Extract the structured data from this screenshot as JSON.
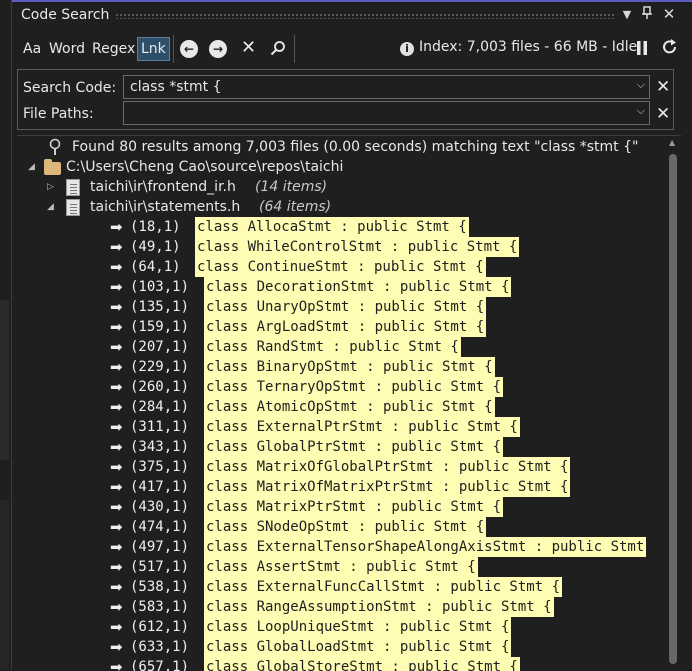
{
  "window": {
    "title": "Code Search"
  },
  "title_icons": [
    "chevron-down-icon",
    "pin-icon",
    "close-icon"
  ],
  "toolbar": {
    "options": [
      {
        "label": "Aa",
        "active": false
      },
      {
        "label": "Word",
        "active": false
      },
      {
        "label": "Regex",
        "active": false
      },
      {
        "label": "Lnk",
        "active": true
      }
    ],
    "nav_icons": [
      "arrow-left-icon",
      "arrow-right-icon",
      "clear-icon",
      "search-icon"
    ],
    "status": "Index: 7,003 files - 66 MB - Idle",
    "status_icon": "info-icon",
    "right_icons": [
      "pause-icon",
      "refresh-icon"
    ]
  },
  "search": {
    "code_label": "Search Code:",
    "code_value": "class *stmt {",
    "paths_label": "File Paths:",
    "paths_value": ""
  },
  "results": {
    "summary": "Found 80 results among 7,003 files (0.00 seconds) matching text \"class *stmt {\"",
    "root_path": "C:\\Users\\Cheng Cao\\source\\repos\\taichi",
    "files": [
      {
        "name": "taichi\\ir\\frontend_ir.h",
        "count": "(14 items)",
        "expanded": false
      },
      {
        "name": "taichi\\ir\\statements.h",
        "count": "(64 items)",
        "expanded": true
      }
    ],
    "matches": [
      {
        "pos": "(18,1)",
        "text": "class AllocaStmt : public Stmt {"
      },
      {
        "pos": "(49,1)",
        "text": "class WhileControlStmt : public Stmt {"
      },
      {
        "pos": "(64,1)",
        "text": "class ContinueStmt : public Stmt {"
      },
      {
        "pos": "(103,1)",
        "text": "class DecorationStmt : public Stmt {"
      },
      {
        "pos": "(135,1)",
        "text": "class UnaryOpStmt : public Stmt {"
      },
      {
        "pos": "(159,1)",
        "text": "class ArgLoadStmt : public Stmt {"
      },
      {
        "pos": "(207,1)",
        "text": "class RandStmt : public Stmt {"
      },
      {
        "pos": "(229,1)",
        "text": "class BinaryOpStmt : public Stmt {"
      },
      {
        "pos": "(260,1)",
        "text": "class TernaryOpStmt : public Stmt {"
      },
      {
        "pos": "(284,1)",
        "text": "class AtomicOpStmt : public Stmt {"
      },
      {
        "pos": "(311,1)",
        "text": "class ExternalPtrStmt : public Stmt {"
      },
      {
        "pos": "(343,1)",
        "text": "class GlobalPtrStmt : public Stmt {"
      },
      {
        "pos": "(375,1)",
        "text": "class MatrixOfGlobalPtrStmt : public Stmt {"
      },
      {
        "pos": "(417,1)",
        "text": "class MatrixOfMatrixPtrStmt : public Stmt {"
      },
      {
        "pos": "(430,1)",
        "text": "class MatrixPtrStmt : public Stmt {"
      },
      {
        "pos": "(474,1)",
        "text": "class SNodeOpStmt : public Stmt {"
      },
      {
        "pos": "(497,1)",
        "text": "class ExternalTensorShapeAlongAxisStmt : public Stmt"
      },
      {
        "pos": "(517,1)",
        "text": "class AssertStmt : public Stmt {"
      },
      {
        "pos": "(538,1)",
        "text": "class ExternalFuncCallStmt : public Stmt {"
      },
      {
        "pos": "(583,1)",
        "text": "class RangeAssumptionStmt : public Stmt {"
      },
      {
        "pos": "(612,1)",
        "text": "class LoopUniqueStmt : public Stmt {"
      },
      {
        "pos": "(633,1)",
        "text": "class GlobalLoadStmt : public Stmt {"
      },
      {
        "pos": "(657,1)",
        "text": "class GlobalStoreStmt : public Stmt {"
      }
    ]
  },
  "colors": {
    "accent": "#5c5cbf",
    "highlight": "#fffdb3",
    "background": "#1f1f1f",
    "active_option": "#2e4f69"
  }
}
